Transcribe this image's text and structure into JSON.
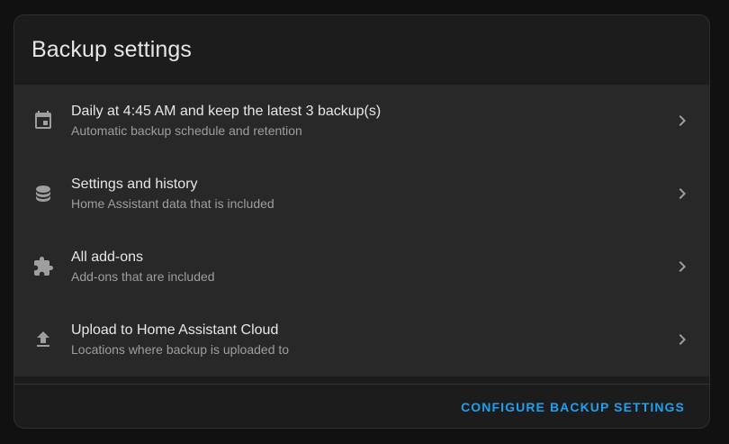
{
  "card": {
    "title": "Backup settings",
    "items": [
      {
        "icon": "calendar-icon",
        "primary": "Daily at 4:45 AM and keep the latest 3 backup(s)",
        "secondary": "Automatic backup schedule and retention"
      },
      {
        "icon": "database-icon",
        "primary": "Settings and history",
        "secondary": "Home Assistant data that is included"
      },
      {
        "icon": "puzzle-icon",
        "primary": "All add-ons",
        "secondary": "Add-ons that are included"
      },
      {
        "icon": "upload-icon",
        "primary": "Upload to Home Assistant Cloud",
        "secondary": "Locations where backup is uploaded to"
      }
    ],
    "action_label": "CONFIGURE BACKUP SETTINGS"
  },
  "colors": {
    "background": "#111111",
    "card": "#1c1c1c",
    "list": "#282828",
    "accent": "#1fa0ee",
    "icon": "#9e9e9e"
  }
}
